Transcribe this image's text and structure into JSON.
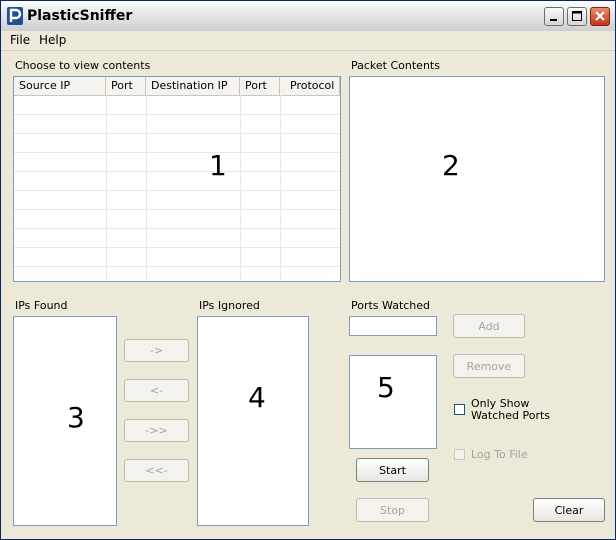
{
  "window": {
    "title": "PlasticSniffer"
  },
  "menu": {
    "file": "File",
    "help": "Help"
  },
  "packets": {
    "label": "Choose to view contents",
    "columns": [
      "Source IP",
      "Port",
      "Destination IP",
      "Port",
      "Protocol"
    ],
    "marker": "1"
  },
  "contents": {
    "label": "Packet Contents",
    "marker": "2"
  },
  "ips_found": {
    "label": "IPs Found",
    "marker": "3"
  },
  "ips_ignored": {
    "label": "IPs Ignored",
    "marker": "4"
  },
  "move_buttons": {
    "move_right": "->",
    "move_left": "<-",
    "move_all_right": "->>",
    "move_all_left": "<<-"
  },
  "ports": {
    "label": "Ports Watched",
    "input_value": "",
    "add": "Add",
    "remove": "Remove",
    "marker": "5",
    "only_show_watched": "Only Show Watched Ports",
    "log_to_file": "Log To File"
  },
  "actions": {
    "start": "Start",
    "stop": "Stop",
    "clear": "Clear"
  }
}
